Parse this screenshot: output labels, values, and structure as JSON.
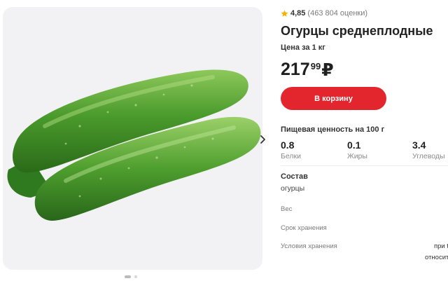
{
  "gallery": {
    "image_alt": "cucumbers",
    "next_icon": "chevron-right-icon",
    "dots": [
      "active",
      "inactive"
    ]
  },
  "product": {
    "rating_value": "4,85",
    "rating_count": "(463 804 оценки)",
    "rating_icon": "star-icon",
    "rating_color": "#f5b301",
    "title": "Огурцы среднеплодные",
    "price_unit_label": "Цена за 1 кг",
    "price_main": "217",
    "price_kop": "99",
    "currency": "₽",
    "cart_button_label": "В корзину",
    "accent_color": "#e3262e"
  },
  "nutrition": {
    "title": "Пищевая ценность на 100 г",
    "items": [
      {
        "value": "0.8",
        "label": "Белки"
      },
      {
        "value": "0.1",
        "label": "Жиры"
      },
      {
        "value": "3.4",
        "label": "Углеводы"
      }
    ]
  },
  "composition": {
    "title": "Состав",
    "value": "огурцы"
  },
  "properties": [
    {
      "label": "Вес",
      "value": ""
    },
    {
      "label": "Срок хранения",
      "value": ""
    },
    {
      "label": "Условия хранения",
      "value": "при t",
      "value2": "относит"
    }
  ]
}
